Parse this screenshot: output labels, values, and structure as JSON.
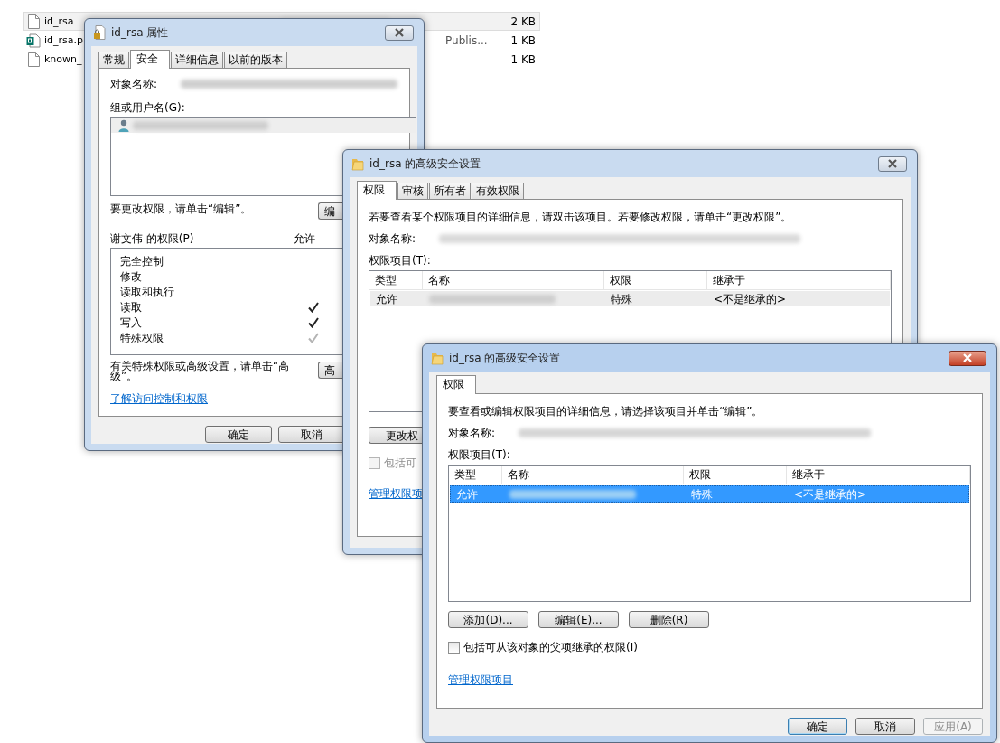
{
  "explorer": {
    "files": [
      {
        "name": "id_rsa",
        "kind": "file",
        "size": "2 KB",
        "selected": true
      },
      {
        "name": "id_rsa.p",
        "kind": "publisher",
        "type": "Publis...",
        "size": "1 KB",
        "selected": false
      },
      {
        "name": "known_",
        "kind": "file",
        "size": "1 KB",
        "selected": false
      }
    ]
  },
  "properties_dialog": {
    "title": "id_rsa 属性",
    "active": false,
    "tabs": [
      {
        "label": "常规",
        "selected": false
      },
      {
        "label": "安全",
        "selected": true
      },
      {
        "label": "详细信息",
        "selected": false
      },
      {
        "label": "以前的版本",
        "selected": false
      }
    ],
    "object_name_label": "对象名称:",
    "group_label": "组或用户名(G):",
    "change_hint": "要更改权限，请单击“编辑”。",
    "edit_button": "编",
    "permissions_label": "谢文伟 的权限(P)",
    "allow_header": "允许",
    "permissions": [
      {
        "name": "完全控制",
        "allowed": false,
        "inherited": false
      },
      {
        "name": "修改",
        "allowed": false,
        "inherited": false
      },
      {
        "name": "读取和执行",
        "allowed": false,
        "inherited": false
      },
      {
        "name": "读取",
        "allowed": true,
        "inherited": false
      },
      {
        "name": "写入",
        "allowed": true,
        "inherited": false
      },
      {
        "name": "特殊权限",
        "allowed": true,
        "inherited": true
      }
    ],
    "advanced_hint": "有关特殊权限或高级设置，请单击“高级”。",
    "advanced_button": "高",
    "link": "了解访问控制和权限",
    "buttons": [
      "确定",
      "取消"
    ]
  },
  "advanced_dialog": {
    "title": "id_rsa 的高级安全设置",
    "active": false,
    "tabs": [
      {
        "label": "权限",
        "selected": true
      },
      {
        "label": "审核",
        "selected": false
      },
      {
        "label": "所有者",
        "selected": false
      },
      {
        "label": "有效权限",
        "selected": false
      }
    ],
    "hint": "若要查看某个权限项目的详细信息，请双击该项目。若要修改权限，请单击“更改权限”。",
    "object_name_label": "对象名称:",
    "entries_label": "权限项目(T):",
    "table": {
      "columns": [
        "类型",
        "名称",
        "权限",
        "继承于"
      ],
      "rows": [
        {
          "type": "允许",
          "permission": "特殊",
          "inherited_from": "<不是继承的>",
          "selected": true
        }
      ]
    },
    "change_button": "更改权",
    "checkbox": {
      "label": "包括可",
      "checked": false,
      "disabled": true
    },
    "link": "管理权限项"
  },
  "edit_dialog": {
    "title": "id_rsa 的高级安全设置",
    "active": true,
    "tabs": [
      {
        "label": "权限",
        "selected": true
      }
    ],
    "hint": "要查看或编辑权限项目的详细信息，请选择该项目并单击“编辑”。",
    "object_name_label": "对象名称:",
    "entries_label": "权限项目(T):",
    "table": {
      "columns": [
        "类型",
        "名称",
        "权限",
        "继承于"
      ],
      "rows": [
        {
          "type": "允许",
          "permission": "特殊",
          "inherited_from": "<不是继承的>",
          "selected": true
        }
      ]
    },
    "buttons": [
      "添加(D)...",
      "编辑(E)...",
      "删除(R)"
    ],
    "checkbox": {
      "label": "包括可从该对象的父项继承的权限(I)",
      "checked": false,
      "disabled": false
    },
    "link": "管理权限项目",
    "footer_buttons": [
      {
        "label": "确定",
        "default": true,
        "disabled": false
      },
      {
        "label": "取消",
        "default": false,
        "disabled": false
      },
      {
        "label": "应用(A)",
        "default": false,
        "disabled": true
      }
    ]
  }
}
